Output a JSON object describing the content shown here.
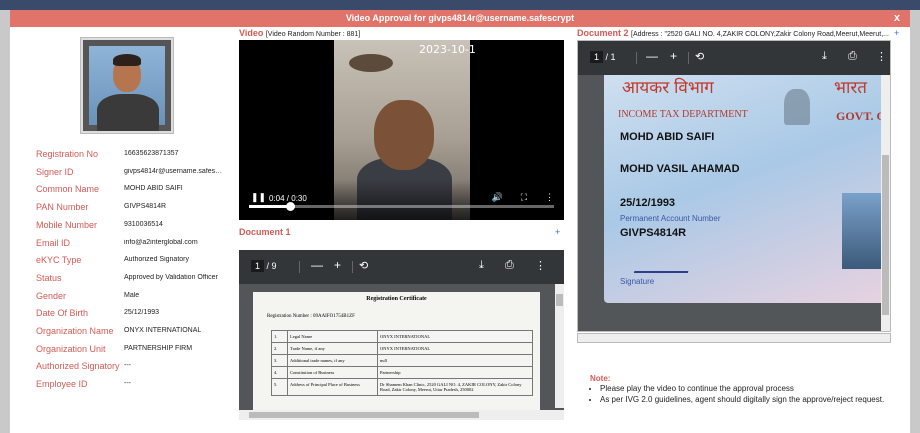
{
  "modal": {
    "title": "Video Approval for givps4814r@username.safescrypt",
    "close": "x"
  },
  "profile": {
    "fields": [
      {
        "label": "Registration No",
        "value": "16635623871357"
      },
      {
        "label": "Signer ID",
        "value": "givps4814r@username.safesc..."
      },
      {
        "label": "Common Name",
        "value": "MOHD ABID SAIFI"
      },
      {
        "label": "PAN Number",
        "value": "GIVPS4814R"
      },
      {
        "label": "Mobile Number",
        "value": "9310036514"
      },
      {
        "label": "Email ID",
        "value": "info@a2interglobal.com"
      },
      {
        "label": "eKYC Type",
        "value": "Authorized Signatory"
      },
      {
        "label": "Status",
        "value": "Approved by Validation Officer"
      },
      {
        "label": "Gender",
        "value": "Male"
      },
      {
        "label": "Date Of Birth",
        "value": "25/12/1993"
      },
      {
        "label": "Organization Name",
        "value": "ONYX INTERNATIONAL"
      },
      {
        "label": "Organization Unit",
        "value": "PARTNERSHIP FIRM"
      },
      {
        "label": "Authorized Signatory",
        "value": "---"
      },
      {
        "label": "Employee ID",
        "value": "---"
      }
    ]
  },
  "video": {
    "heading": "Video",
    "subheading": "[Video Random Number : 881]",
    "timestamp_overlay": "2023-10-1",
    "time": "0:04 / 0:30",
    "progress": 0.133
  },
  "doc1": {
    "heading": "Document 1",
    "plus": "+",
    "page_current": "1",
    "page_total": "/ 9",
    "cert_title": "Registration Certificate",
    "cert_regno": "Registration Number : 09AAIFO1754B1ZF",
    "rows": [
      {
        "n": "1.",
        "k": "Legal Name",
        "v": "ONYX INTERNATIONAL"
      },
      {
        "n": "2.",
        "k": "Trade Name, if any",
        "v": "ONYX INTERNATIONAL"
      },
      {
        "n": "3.",
        "k": "Additional trade names, if any",
        "v": "null"
      },
      {
        "n": "4.",
        "k": "Constitution of Business",
        "v": "Partnership"
      },
      {
        "n": "5.",
        "k": "Address of Principal Place of Business",
        "v": "Dr Shamem Khan Clinic, 2520 GALI NO. 4, ZAKIR COLONY, Zakir Colony Road, Zakir Colony, Meerut, Uttar Pradesh, 250002"
      }
    ]
  },
  "doc2": {
    "heading": "Document 2",
    "subheading": "[Address : \"2520 GALI NO. 4,ZAKIR COLONY,Zakir Colony Road,Meerut,Meerut,...",
    "plus": "+",
    "page_current": "1",
    "page_total": "/ 1",
    "card": {
      "hindi_left": "आयकर विभाग",
      "hindi_right": "भारत",
      "dept": "INCOME TAX DEPARTMENT",
      "govt": "GOVT. O",
      "name": "MOHD ABID SAIFI",
      "father": "MOHD VASIL AHAMAD",
      "dob": "25/12/1993",
      "pan_label": "Permanent Account Number",
      "pan": "GIVPS4814R",
      "signature_label": "Signature"
    }
  },
  "note": {
    "title": "Note:",
    "items": [
      "Please play the video to continue the approval process",
      "As per IVG 2.0 guidelines, agent should digitally sign the approve/reject request."
    ]
  }
}
